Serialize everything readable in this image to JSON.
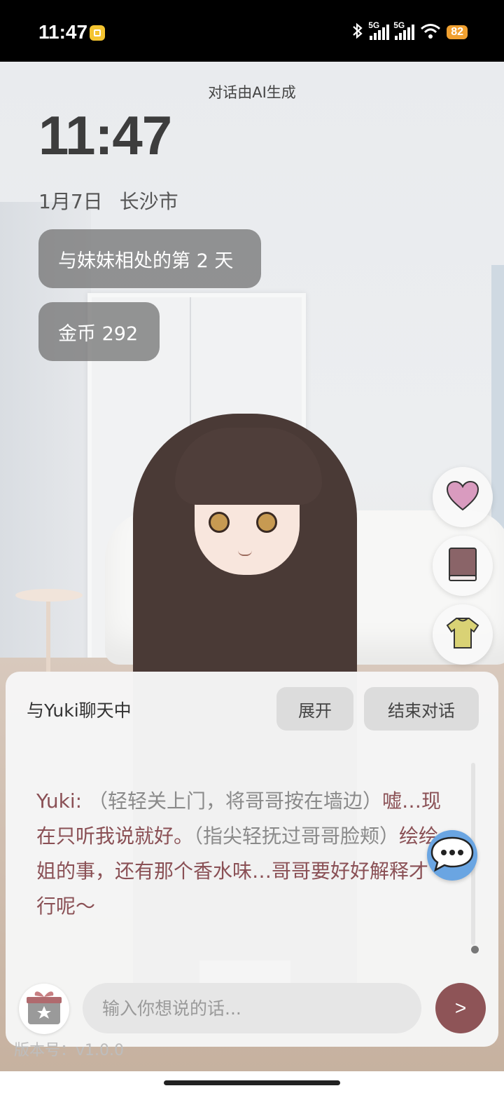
{
  "status_bar": {
    "time": "11:47",
    "network_1": "5G",
    "network_2": "5G",
    "battery": "82"
  },
  "header": {
    "ai_note": "对话由AI生成",
    "clock": "11:47",
    "date": "1月7日",
    "city": "长沙市"
  },
  "stats": {
    "days_label": "与妹妹相处的第 2 天",
    "coins_label": "金币 292"
  },
  "side_buttons": [
    {
      "icon": "heart-icon",
      "color": "#d99bbf"
    },
    {
      "icon": "book-icon",
      "color": "#8a6468"
    },
    {
      "icon": "shirt-icon",
      "color": "#d9d275"
    }
  ],
  "chat": {
    "title": "与Yuki聊天中",
    "expand_label": "展开",
    "end_label": "结束对话",
    "speaker": "Yuki:",
    "action_1": " （轻轻关上门，将哥哥按在墙边）",
    "speech_1": "嘘…现在只听我说就好。",
    "action_2": "（指尖轻抚过哥哥脸颊）",
    "speech_2": "绘绘姐的事，还有那个香水味…哥哥要好好解释才行呢～",
    "input_placeholder": "输入你想说的话...",
    "send_label": ">",
    "version": "版本号：v1.0.0"
  },
  "colors": {
    "accent": "#8e5457",
    "bubble": "#6aa5e2",
    "battery": "#f0a030"
  }
}
